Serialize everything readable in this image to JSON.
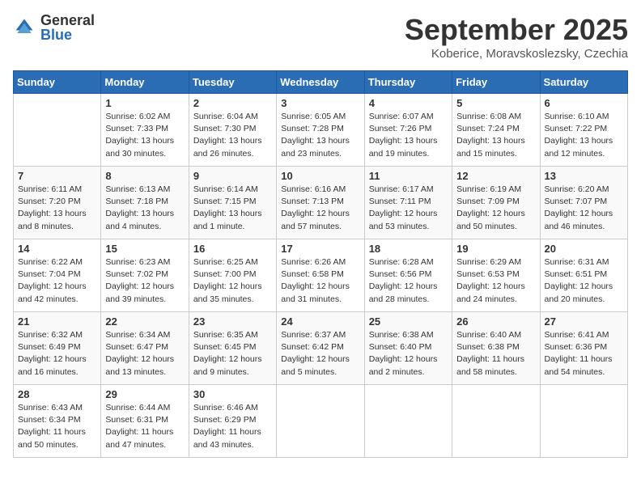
{
  "logo": {
    "general": "General",
    "blue": "Blue"
  },
  "header": {
    "month": "September 2025",
    "location": "Koberice, Moravskoslezsky, Czechia"
  },
  "weekdays": [
    "Sunday",
    "Monday",
    "Tuesday",
    "Wednesday",
    "Thursday",
    "Friday",
    "Saturday"
  ],
  "weeks": [
    [
      {
        "day": "",
        "info": ""
      },
      {
        "day": "1",
        "info": "Sunrise: 6:02 AM\nSunset: 7:33 PM\nDaylight: 13 hours and 30 minutes."
      },
      {
        "day": "2",
        "info": "Sunrise: 6:04 AM\nSunset: 7:30 PM\nDaylight: 13 hours and 26 minutes."
      },
      {
        "day": "3",
        "info": "Sunrise: 6:05 AM\nSunset: 7:28 PM\nDaylight: 13 hours and 23 minutes."
      },
      {
        "day": "4",
        "info": "Sunrise: 6:07 AM\nSunset: 7:26 PM\nDaylight: 13 hours and 19 minutes."
      },
      {
        "day": "5",
        "info": "Sunrise: 6:08 AM\nSunset: 7:24 PM\nDaylight: 13 hours and 15 minutes."
      },
      {
        "day": "6",
        "info": "Sunrise: 6:10 AM\nSunset: 7:22 PM\nDaylight: 13 hours and 12 minutes."
      }
    ],
    [
      {
        "day": "7",
        "info": "Sunrise: 6:11 AM\nSunset: 7:20 PM\nDaylight: 13 hours and 8 minutes."
      },
      {
        "day": "8",
        "info": "Sunrise: 6:13 AM\nSunset: 7:18 PM\nDaylight: 13 hours and 4 minutes."
      },
      {
        "day": "9",
        "info": "Sunrise: 6:14 AM\nSunset: 7:15 PM\nDaylight: 13 hours and 1 minute."
      },
      {
        "day": "10",
        "info": "Sunrise: 6:16 AM\nSunset: 7:13 PM\nDaylight: 12 hours and 57 minutes."
      },
      {
        "day": "11",
        "info": "Sunrise: 6:17 AM\nSunset: 7:11 PM\nDaylight: 12 hours and 53 minutes."
      },
      {
        "day": "12",
        "info": "Sunrise: 6:19 AM\nSunset: 7:09 PM\nDaylight: 12 hours and 50 minutes."
      },
      {
        "day": "13",
        "info": "Sunrise: 6:20 AM\nSunset: 7:07 PM\nDaylight: 12 hours and 46 minutes."
      }
    ],
    [
      {
        "day": "14",
        "info": "Sunrise: 6:22 AM\nSunset: 7:04 PM\nDaylight: 12 hours and 42 minutes."
      },
      {
        "day": "15",
        "info": "Sunrise: 6:23 AM\nSunset: 7:02 PM\nDaylight: 12 hours and 39 minutes."
      },
      {
        "day": "16",
        "info": "Sunrise: 6:25 AM\nSunset: 7:00 PM\nDaylight: 12 hours and 35 minutes."
      },
      {
        "day": "17",
        "info": "Sunrise: 6:26 AM\nSunset: 6:58 PM\nDaylight: 12 hours and 31 minutes."
      },
      {
        "day": "18",
        "info": "Sunrise: 6:28 AM\nSunset: 6:56 PM\nDaylight: 12 hours and 28 minutes."
      },
      {
        "day": "19",
        "info": "Sunrise: 6:29 AM\nSunset: 6:53 PM\nDaylight: 12 hours and 24 minutes."
      },
      {
        "day": "20",
        "info": "Sunrise: 6:31 AM\nSunset: 6:51 PM\nDaylight: 12 hours and 20 minutes."
      }
    ],
    [
      {
        "day": "21",
        "info": "Sunrise: 6:32 AM\nSunset: 6:49 PM\nDaylight: 12 hours and 16 minutes."
      },
      {
        "day": "22",
        "info": "Sunrise: 6:34 AM\nSunset: 6:47 PM\nDaylight: 12 hours and 13 minutes."
      },
      {
        "day": "23",
        "info": "Sunrise: 6:35 AM\nSunset: 6:45 PM\nDaylight: 12 hours and 9 minutes."
      },
      {
        "day": "24",
        "info": "Sunrise: 6:37 AM\nSunset: 6:42 PM\nDaylight: 12 hours and 5 minutes."
      },
      {
        "day": "25",
        "info": "Sunrise: 6:38 AM\nSunset: 6:40 PM\nDaylight: 12 hours and 2 minutes."
      },
      {
        "day": "26",
        "info": "Sunrise: 6:40 AM\nSunset: 6:38 PM\nDaylight: 11 hours and 58 minutes."
      },
      {
        "day": "27",
        "info": "Sunrise: 6:41 AM\nSunset: 6:36 PM\nDaylight: 11 hours and 54 minutes."
      }
    ],
    [
      {
        "day": "28",
        "info": "Sunrise: 6:43 AM\nSunset: 6:34 PM\nDaylight: 11 hours and 50 minutes."
      },
      {
        "day": "29",
        "info": "Sunrise: 6:44 AM\nSunset: 6:31 PM\nDaylight: 11 hours and 47 minutes."
      },
      {
        "day": "30",
        "info": "Sunrise: 6:46 AM\nSunset: 6:29 PM\nDaylight: 11 hours and 43 minutes."
      },
      {
        "day": "",
        "info": ""
      },
      {
        "day": "",
        "info": ""
      },
      {
        "day": "",
        "info": ""
      },
      {
        "day": "",
        "info": ""
      }
    ]
  ]
}
